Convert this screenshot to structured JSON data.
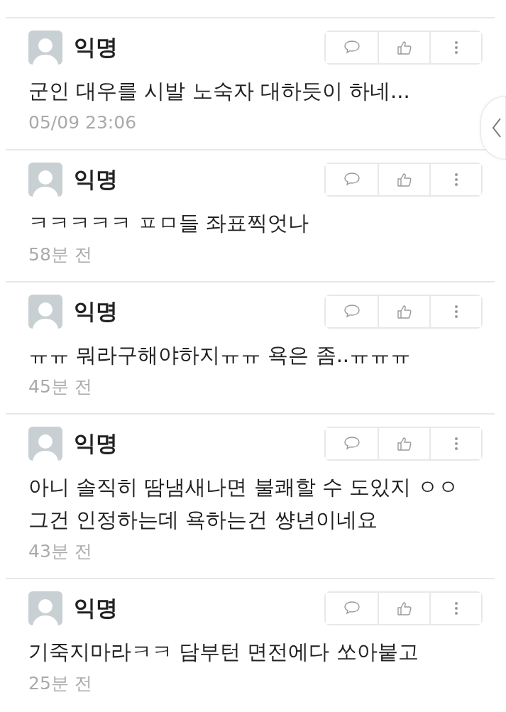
{
  "comments": [
    {
      "author": "익명",
      "text": [
        "군인 대우를 시발 노숙자 대하듯이 하네..."
      ],
      "time": "05/09 23:06"
    },
    {
      "author": "익명",
      "text": [
        "ㅋㅋㅋㅋㅋ ㅍㅁ들 좌표찍엇나"
      ],
      "time": "58분 전"
    },
    {
      "author": "익명",
      "text": [
        "ㅠㅠ 뭐라구해야하지ㅠㅠ 욕은 좀..ㅠㅠㅠ"
      ],
      "time": "45분 전"
    },
    {
      "author": "익명",
      "text": [
        "아니 솔직히 땀냄새나면 불쾌할 수 도있지 ㅇㅇ",
        "그건 인정하는데 욕하는건 썅년이네요"
      ],
      "time": "43분 전"
    },
    {
      "author": "익명",
      "text": [
        "기죽지마라ㅋㅋ 담부턴 면전에다 쏘아붙고"
      ],
      "time": "25분 전"
    }
  ]
}
